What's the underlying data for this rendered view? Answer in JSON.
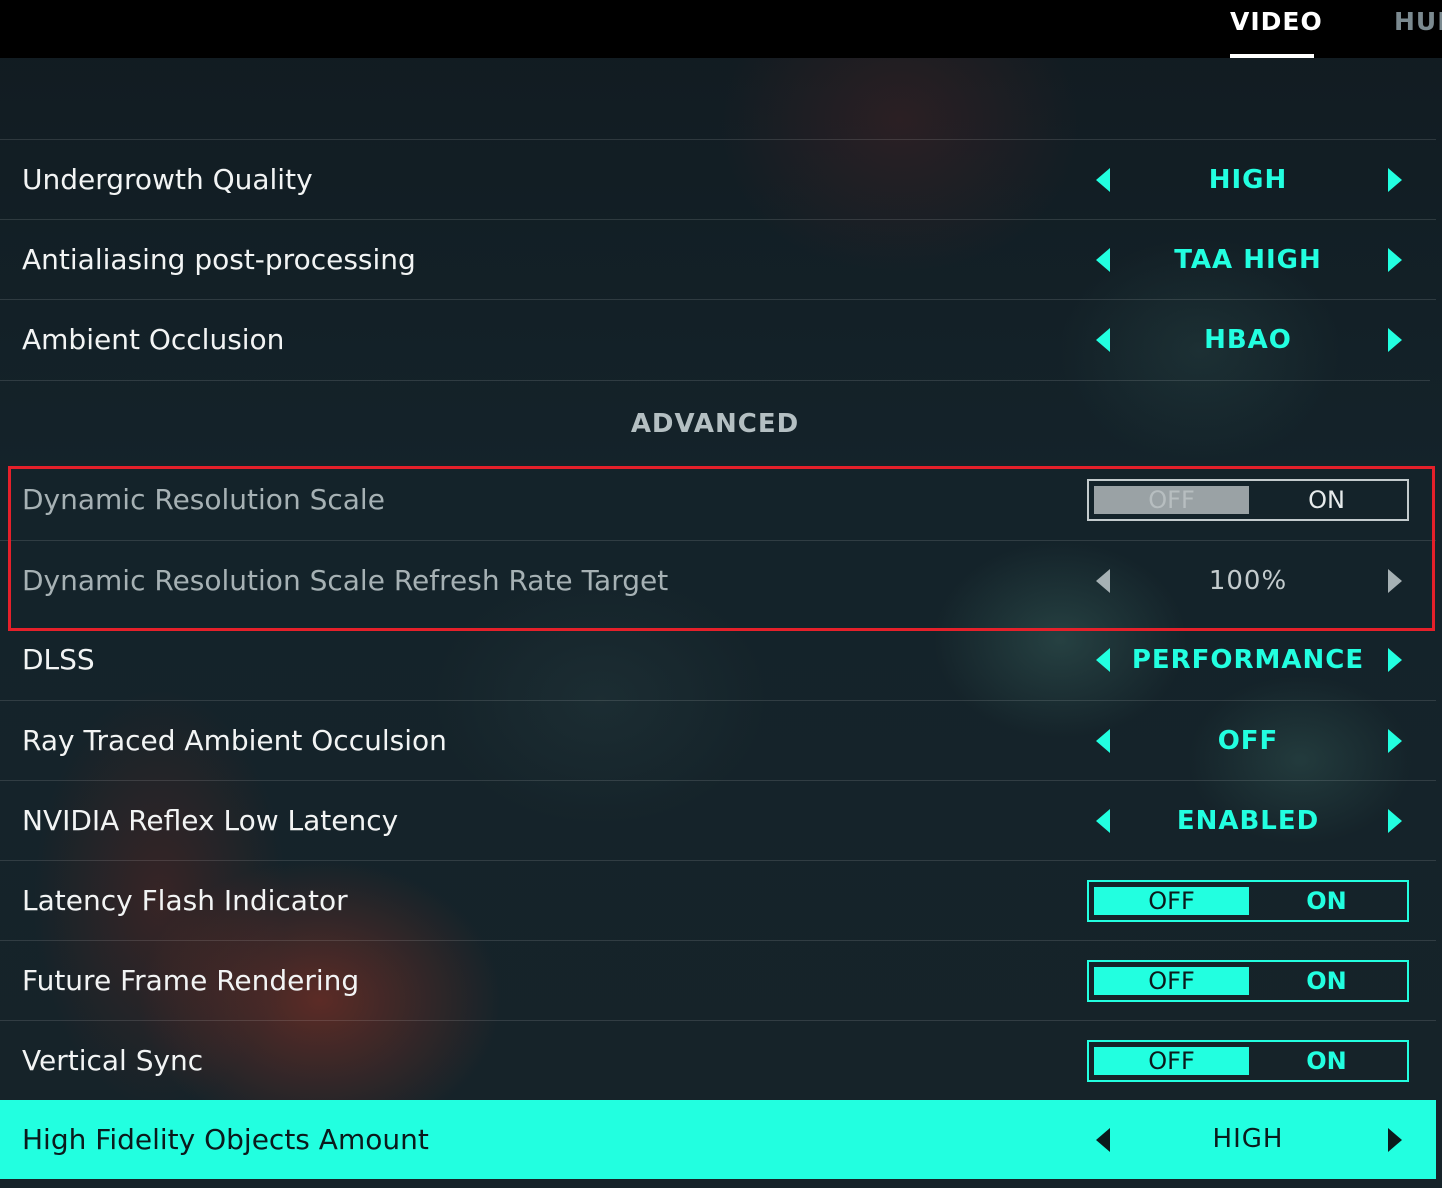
{
  "tabs": {
    "video": "VIDEO",
    "hud": "HUD"
  },
  "section_advanced": "ADVANCED",
  "rows": [
    {
      "label": "Undergrowth Quality",
      "value": "HIGH"
    },
    {
      "label": "Antialiasing post-processing",
      "value": "TAA HIGH"
    },
    {
      "label": "Ambient Occlusion",
      "value": "HBAO"
    },
    {
      "label": "Dynamic Resolution Scale",
      "toggle": {
        "off": "OFF",
        "on": "ON",
        "selected": "OFF",
        "disabled": true
      }
    },
    {
      "label": "Dynamic Resolution Scale Refresh Rate Target",
      "value": "100%",
      "disabled": true
    },
    {
      "label": "DLSS",
      "value": "PERFORMANCE"
    },
    {
      "label": "Ray Traced Ambient Occulsion",
      "value": "OFF"
    },
    {
      "label": "NVIDIA Reflex Low Latency",
      "value": "ENABLED"
    },
    {
      "label": "Latency Flash Indicator",
      "toggle": {
        "off": "OFF",
        "on": "ON",
        "selected": "OFF"
      }
    },
    {
      "label": "Future Frame Rendering",
      "toggle": {
        "off": "OFF",
        "on": "ON",
        "selected": "OFF"
      }
    },
    {
      "label": "Vertical Sync",
      "toggle": {
        "off": "OFF",
        "on": "ON",
        "selected": "OFF"
      }
    },
    {
      "label": "High Fidelity Objects Amount",
      "value": "HIGH",
      "focused": true
    }
  ],
  "colors": {
    "accent": "#22ffe0",
    "highlight_border": "#e5202a",
    "topbar": "#000000"
  }
}
